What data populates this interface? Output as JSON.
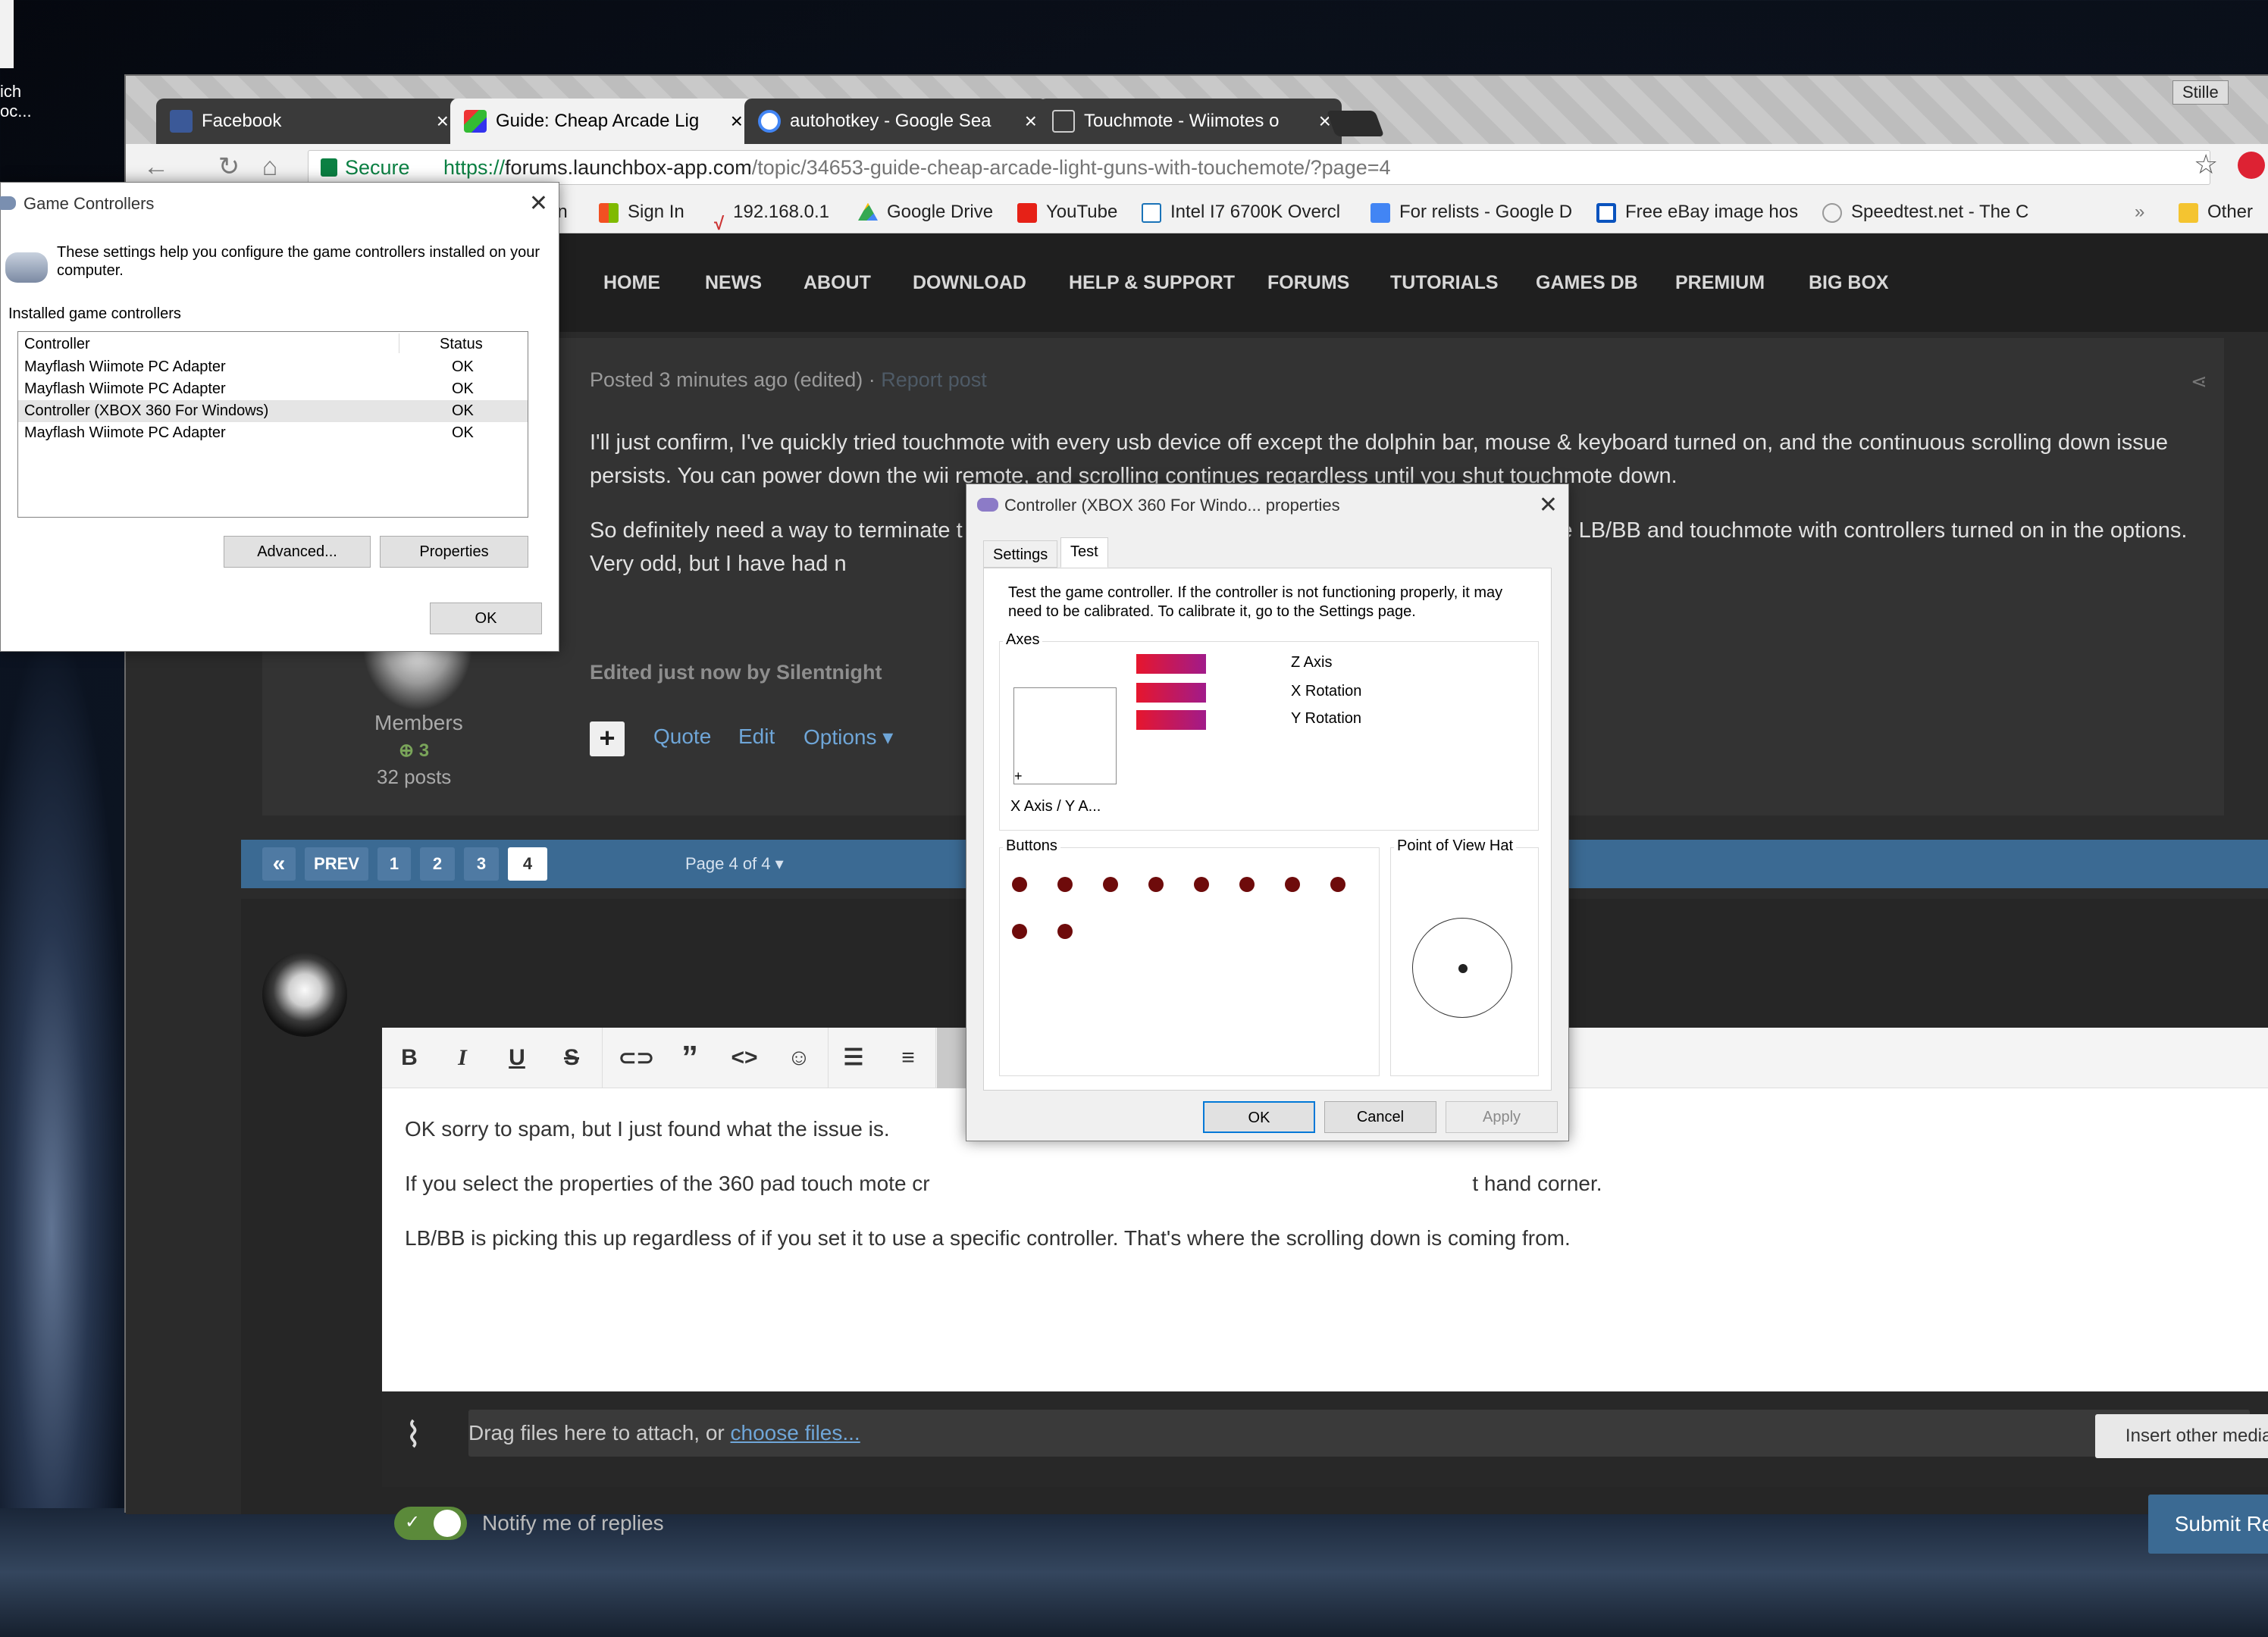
{
  "desktop": {
    "icon_label": "ich\noc..."
  },
  "browser": {
    "tabs": [
      {
        "title": "Facebook"
      },
      {
        "title": "Guide: Cheap Arcade Lig"
      },
      {
        "title": "autohotkey - Google Sea"
      },
      {
        "title": "Touchmote - Wiimotes o"
      }
    ],
    "profile_name": "Stille",
    "secure_label": "Secure",
    "url_scheme": "https://",
    "url_domain": "forums.launchbox-app.com",
    "url_path": "/topic/34653-guide-cheap-arcade-light-guns-with-touchemote/?page=4",
    "bookmarks": [
      {
        "label": "an"
      },
      {
        "label": "Sign In"
      },
      {
        "label": "192.168.0.1"
      },
      {
        "label": "Google Drive"
      },
      {
        "label": "YouTube"
      },
      {
        "label": "Intel I7 6700K Overcl"
      },
      {
        "label": "For relists - Google D"
      },
      {
        "label": "Free eBay image hos"
      },
      {
        "label": "Speedtest.net - The C"
      },
      {
        "label": "Other"
      }
    ],
    "overflow": "»"
  },
  "site": {
    "nav": [
      "HOME",
      "NEWS",
      "ABOUT",
      "DOWNLOAD",
      "HELP & SUPPORT",
      "FORUMS",
      "TUTORIALS",
      "GAMES DB",
      "PREMIUM",
      "BIG BOX"
    ],
    "post": {
      "meta": "Posted 3 minutes ago (edited) · ",
      "report": "Report post",
      "p1": "I'll just confirm, I've quickly tried touchmote with every usb device off except the dolphin bar, mouse & keyboard turned on, and the continuous scrolling down issue persists. You can power down the wii remote, and scrolling continues regardless until you shut touchmote down.",
      "p2": "So definitely need a way to terminate t                                                                                  doesn't like LB/BB and touchmote with controllers turned on in the options. Very odd, but I have had n",
      "edited": "Edited just now by Silentnight",
      "actions": {
        "quote": "Quote",
        "edit": "Edit",
        "options": "Options ▾"
      },
      "author": {
        "group": "Members",
        "reputation": "3",
        "posts": "32 posts"
      }
    },
    "pager": {
      "first": "«",
      "prev": "PREV",
      "pages": [
        "1",
        "2",
        "3",
        "4"
      ],
      "current": "4",
      "label": "Page 4 of 4 ▾"
    },
    "reply": {
      "p1": "OK sorry to spam, but I just found what the issue is.",
      "p2": "If you select the properties of the 360 pad touch mote cr                                                                                            t hand corner.",
      "p3": "LB/BB is picking this up regardless of if you set it to use a specific controller. That's where the scrolling down is coming from.",
      "attach_text": "Drag files here to attach, or ",
      "attach_link": "choose files...",
      "insert_media": "Insert other media ▾",
      "notify": "Notify me of replies",
      "submit": "Submit Reply"
    }
  },
  "game_controllers": {
    "title": "Game Controllers",
    "description": "These settings help you configure the game controllers installed on your computer.",
    "installed_label": "Installed game controllers",
    "col_controller": "Controller",
    "col_status": "Status",
    "rows": [
      {
        "name": "Mayflash Wiimote PC Adapter",
        "status": "OK"
      },
      {
        "name": "Mayflash Wiimote PC Adapter",
        "status": "OK"
      },
      {
        "name": "Controller (XBOX 360 For Windows)",
        "status": "OK"
      },
      {
        "name": "Mayflash Wiimote PC Adapter",
        "status": "OK"
      }
    ],
    "advanced": "Advanced...",
    "properties": "Properties",
    "ok": "OK"
  },
  "properties": {
    "title": "Controller (XBOX 360 For Windo... properties",
    "tab_settings": "Settings",
    "tab_test": "Test",
    "description": "Test the game controller.  If the controller is not functioning properly, it may need to be calibrated.  To calibrate it, go to the Settings page.",
    "axes_label": "Axes",
    "z_axis": "Z Axis",
    "x_rotation": "X Rotation",
    "y_rotation": "Y Rotation",
    "xy_label": "X Axis / Y A...",
    "buttons_label": "Buttons",
    "pov_label": "Point of View Hat",
    "ok": "OK",
    "cancel": "Cancel",
    "apply": "Apply"
  }
}
